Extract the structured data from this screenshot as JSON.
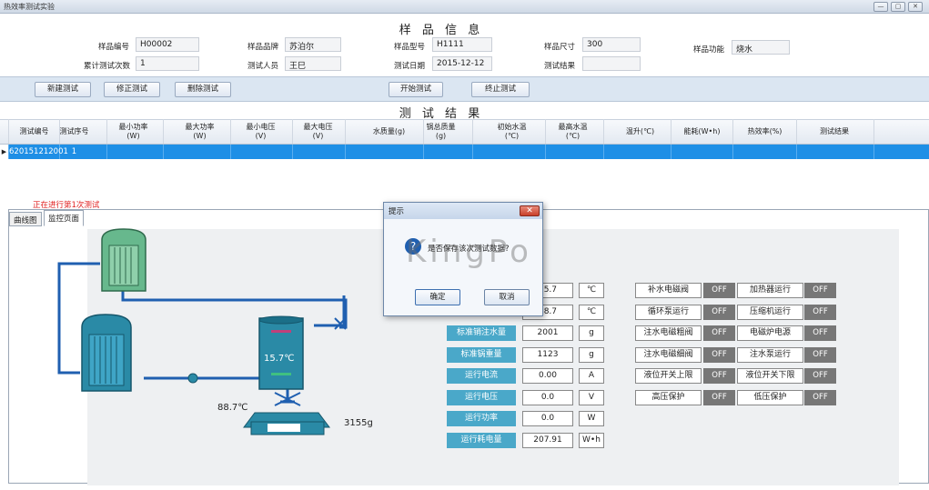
{
  "window": {
    "title": "热效率测试实验",
    "controls": [
      "—",
      "▢",
      "✕"
    ]
  },
  "sample": {
    "section_title": "样 品 信 息",
    "code_label": "样品编号",
    "code": "H00002",
    "brand_label": "样品品牌",
    "brand": "苏泊尔",
    "model_label": "样品型号",
    "model": "H1111",
    "size_label": "样品尺寸",
    "size": "300",
    "function_label": "样品功能",
    "function": "烧水",
    "count_label": "累计测试次数",
    "count": "1",
    "tester_label": "测试人员",
    "tester": "王巳",
    "date_label": "测试日期",
    "date": "2015-12-12",
    "result_label": "测试结果",
    "result": ""
  },
  "toolbar": {
    "new": "新建测试",
    "edit": "修正测试",
    "delete": "删除测试",
    "start": "开始测试",
    "stop": "终止测试"
  },
  "results": {
    "section_title": "测 试 结 果",
    "columns": [
      "测试编号",
      "测试序号",
      "最小功率\n(W)",
      "最大功率\n(W)",
      "最小电压\n(V)",
      "最大电压\n(V)",
      "水质量(g)",
      "锅总质量\n(g)",
      "初始水温\n(℃)",
      "最高水温\n(℃)",
      "温升(℃)",
      "能耗(W•h)",
      "热效率(%)",
      "测试结果"
    ],
    "rows": [
      [
        "620151212001",
        "1",
        "",
        "",
        "",
        "",
        "",
        "",
        "",
        "",
        "",
        "",
        "",
        ""
      ]
    ]
  },
  "status": "正在进行第1次测试",
  "tabs": [
    "曲线图",
    "监控页面"
  ],
  "monitor": {
    "tank_temp": "15.7℃",
    "init_temp": "88.7℃",
    "scale_weight": "3155g",
    "readings": [
      {
        "label": "",
        "value": "15.7",
        "unit": "℃"
      },
      {
        "label": "",
        "value": "88.7",
        "unit": "℃"
      },
      {
        "label": "标准销注水量",
        "value": "2001",
        "unit": "g"
      },
      {
        "label": "标准锅重量",
        "value": "1123",
        "unit": "g"
      },
      {
        "label": "运行电流",
        "value": "0.00",
        "unit": "A"
      },
      {
        "label": "运行电压",
        "value": "0.0",
        "unit": "V"
      },
      {
        "label": "运行功率",
        "value": "0.0",
        "unit": "W"
      },
      {
        "label": "运行耗电量",
        "value": "207.91",
        "unit": "W•h"
      }
    ],
    "switches": [
      [
        "补水电磁阀",
        "OFF",
        "加热器运行",
        "OFF"
      ],
      [
        "循环泵运行",
        "OFF",
        "压缩机运行",
        "OFF"
      ],
      [
        "注水电磁粗阀",
        "OFF",
        "电磁炉电源",
        "OFF"
      ],
      [
        "注水电磁细阀",
        "OFF",
        "注水泵运行",
        "OFF"
      ],
      [
        "液位开关上限",
        "OFF",
        "液位开关下限",
        "OFF"
      ],
      [
        "高压保护",
        "OFF",
        "低压保护",
        "OFF"
      ]
    ]
  },
  "dialog": {
    "title": "提示",
    "message": "是否保存该次测试数据?",
    "ok": "确定",
    "cancel": "取消",
    "watermark": "KingPo"
  },
  "colors": {
    "accent": "#1e8fe6",
    "label_bg": "#4aa8c9",
    "tank": "#2a8aa6",
    "status": "#e02020"
  }
}
